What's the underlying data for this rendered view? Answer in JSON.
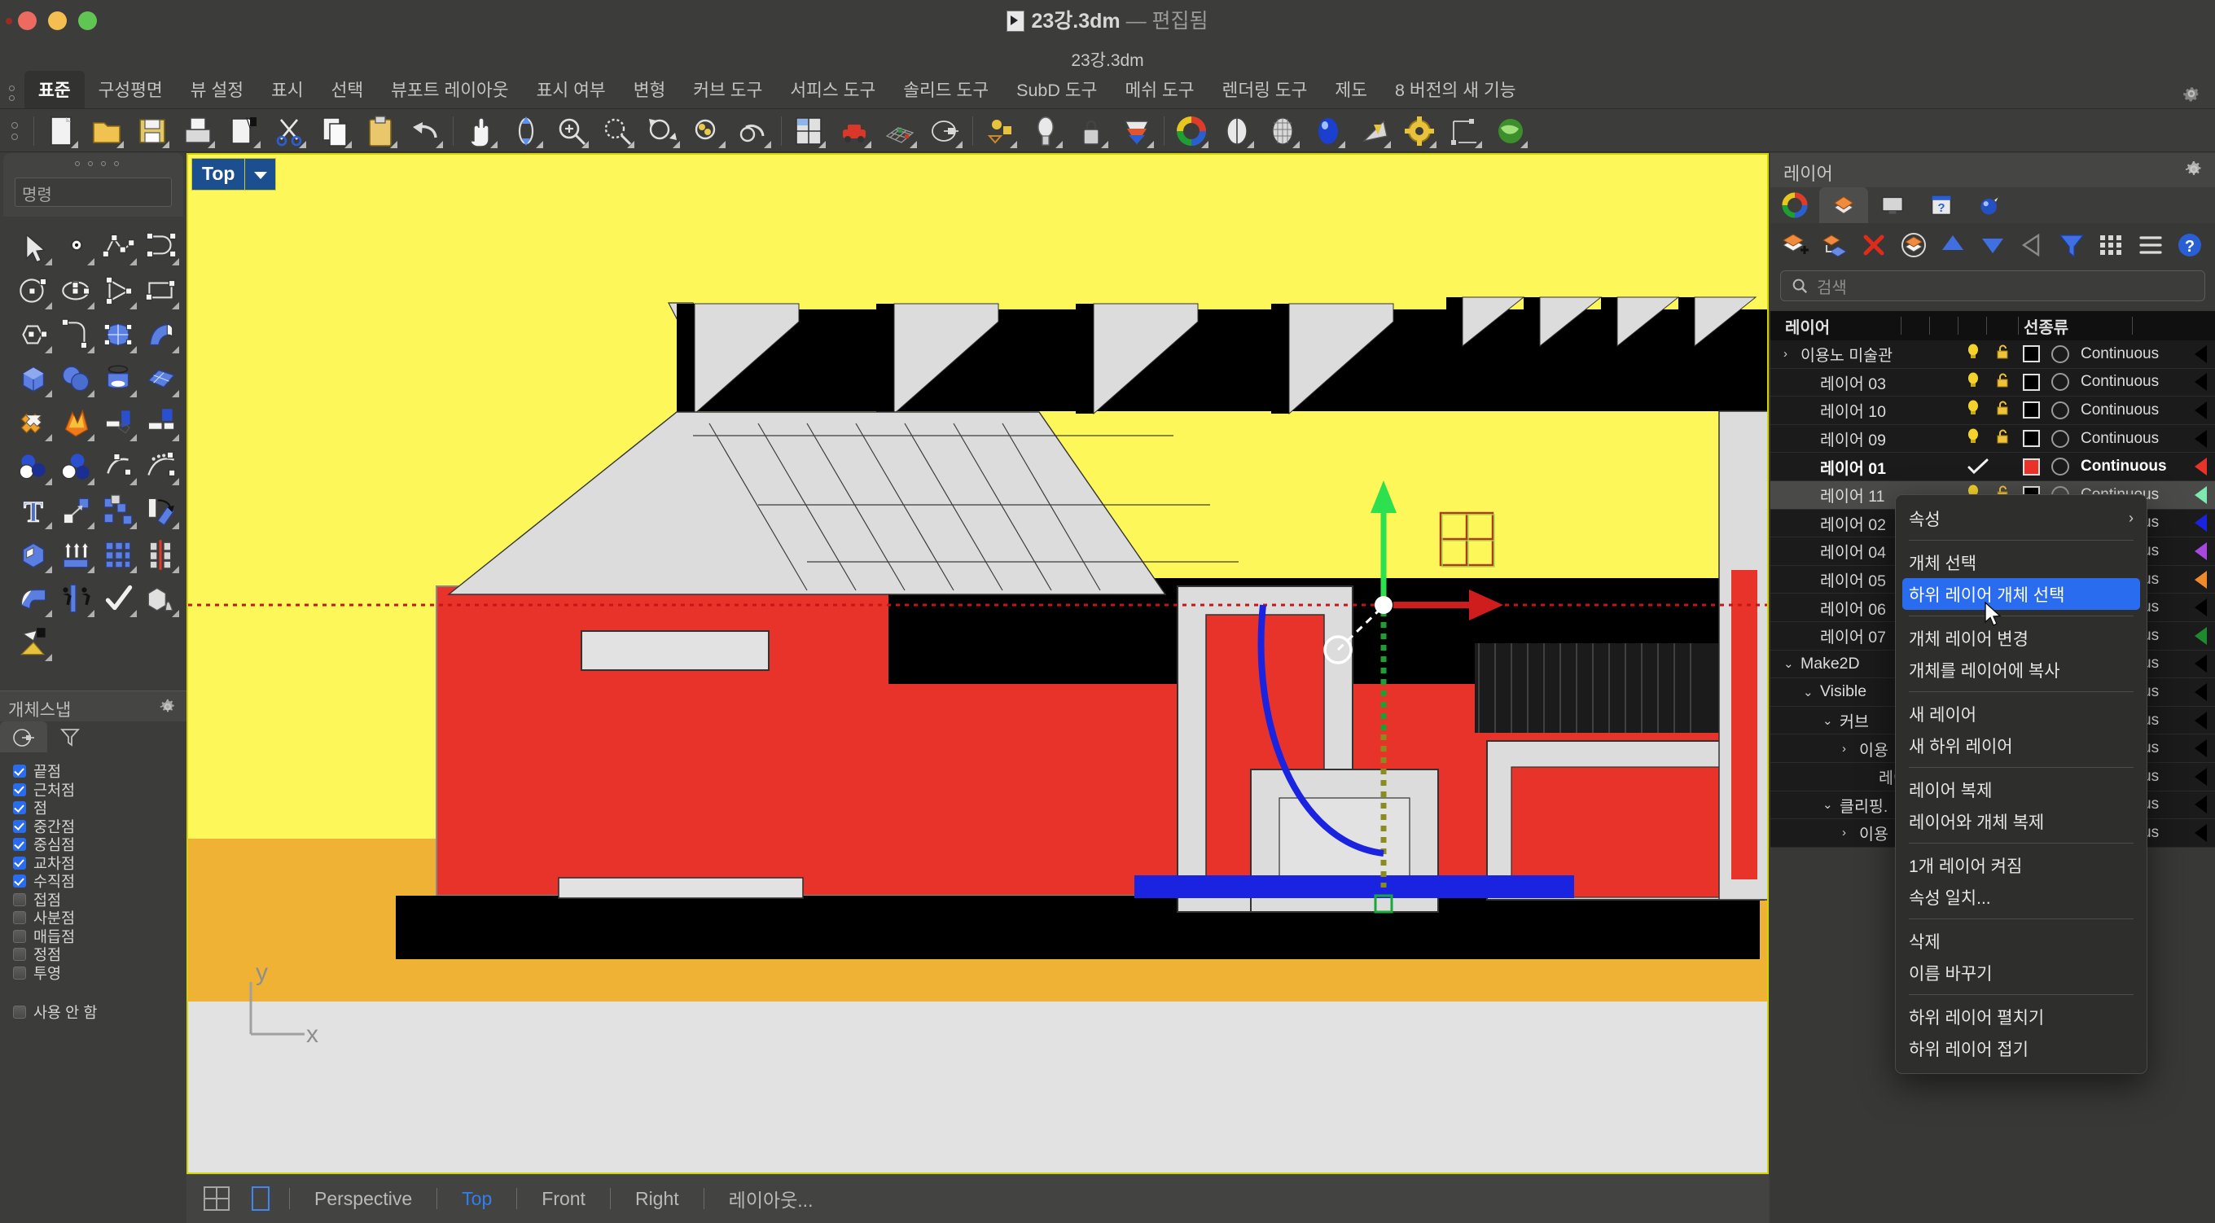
{
  "window": {
    "title": "23강.3dm",
    "title_dash": "—",
    "title_state": "편집됨",
    "subtitle": "23강.3dm"
  },
  "menubar": {
    "tabs": [
      {
        "label": "표준",
        "active": true
      },
      {
        "label": "구성평면",
        "active": false
      },
      {
        "label": "뷰 설정",
        "active": false
      },
      {
        "label": "표시",
        "active": false
      },
      {
        "label": "선택",
        "active": false
      },
      {
        "label": "뷰포트 레이아웃",
        "active": false
      },
      {
        "label": "표시 여부",
        "active": false
      },
      {
        "label": "변형",
        "active": false
      },
      {
        "label": "커브 도구",
        "active": false
      },
      {
        "label": "서피스 도구",
        "active": false
      },
      {
        "label": "솔리드 도구",
        "active": false
      },
      {
        "label": "SubD 도구",
        "active": false
      },
      {
        "label": "메쉬 도구",
        "active": false
      },
      {
        "label": "렌더링 도구",
        "active": false
      },
      {
        "label": "제도",
        "active": false
      },
      {
        "label": "8 버전의 새 기능",
        "active": false
      }
    ]
  },
  "toolbar": {
    "icons": [
      "new-file-icon",
      "open-folder-icon",
      "save-icon",
      "print-icon",
      "import-icon",
      "cut-scissors-icon",
      "copy-icon",
      "paste-icon",
      "undo-icon",
      "pan-hand-icon",
      "rotate-view-icon",
      "zoom-in-icon",
      "zoom-window-icon",
      "zoom-extents-icon",
      "zoom-selected-icon",
      "undo-view-icon",
      "viewport-layout-icon",
      "named-view-icon",
      "grid-snap-icon",
      "planar-icon",
      "gumball-icon",
      "light-icon",
      "lock-icon",
      "shaded-display-icon",
      "color-wheel-icon",
      "render-preview-icon",
      "render-mesh-icon",
      "render-icon",
      "spotlight-icon",
      "gear-options-icon",
      "dimension-icon",
      "environment-icon"
    ]
  },
  "command": {
    "placeholder": "명령"
  },
  "osnap": {
    "title": "개체스냅",
    "tabs": [
      "osnap-tab-icon",
      "filter-tab-icon"
    ],
    "items": [
      {
        "label": "끝점",
        "checked": true
      },
      {
        "label": "근처점",
        "checked": true
      },
      {
        "label": "점",
        "checked": true
      },
      {
        "label": "중간점",
        "checked": true
      },
      {
        "label": "중심점",
        "checked": true
      },
      {
        "label": "교차점",
        "checked": true
      },
      {
        "label": "수직점",
        "checked": true
      },
      {
        "label": "접점",
        "checked": false
      },
      {
        "label": "사분점",
        "checked": false
      },
      {
        "label": "매듭점",
        "checked": false
      },
      {
        "label": "정점",
        "checked": false
      },
      {
        "label": "투영",
        "checked": false
      }
    ],
    "disable": {
      "label": "사용 안 함",
      "checked": false
    }
  },
  "viewport": {
    "label": "Top",
    "axis_y": "y",
    "axis_x": "x",
    "bg_color": "#e2e2e2",
    "yellow": "#fdf75a",
    "orange": "#f0b235",
    "red": "#e8332a",
    "blue": "#1a23e0",
    "black": "#000000",
    "gray": "#dcdcdc"
  },
  "viewport_bar": {
    "icons": [
      "four-view-icon",
      "single-view-icon"
    ],
    "tabs": [
      {
        "label": "Perspective",
        "selected": false
      },
      {
        "label": "Top",
        "selected": true
      },
      {
        "label": "Front",
        "selected": false
      },
      {
        "label": "Right",
        "selected": false
      },
      {
        "label": "레이아웃...",
        "selected": false
      }
    ]
  },
  "layers_panel": {
    "title": "레이어",
    "tabs": [
      "color-wheel-tab-icon",
      "layers-tab-icon",
      "display-tab-icon",
      "help-tab-icon",
      "render-tab-icon"
    ],
    "tools": [
      "new-layer-icon",
      "new-sublayer-icon",
      "delete-layer-icon",
      "current-layer-icon",
      "move-up-icon",
      "move-down-icon",
      "filter-left-icon",
      "filter-funnel-icon",
      "grid-view-icon",
      "list-view-icon",
      "help-icon"
    ],
    "search_placeholder": "검색",
    "columns": {
      "name": "레이어",
      "linetype": "선종류"
    },
    "rows": [
      {
        "name": "이용노 미술관",
        "indent": 0,
        "chevron": "right",
        "bulb": true,
        "lock": true,
        "color": "#000000",
        "linetype": "Continuous",
        "print": "#000000",
        "current": false,
        "selected": false,
        "bold": false
      },
      {
        "name": "레이어 03",
        "indent": 1,
        "chevron": "",
        "bulb": true,
        "lock": true,
        "color": "#000000",
        "linetype": "Continuous",
        "print": "#000000",
        "current": false,
        "selected": false,
        "bold": false
      },
      {
        "name": "레이어 10",
        "indent": 1,
        "chevron": "",
        "bulb": true,
        "lock": true,
        "color": "#000000",
        "linetype": "Continuous",
        "print": "#000000",
        "current": false,
        "selected": false,
        "bold": false
      },
      {
        "name": "레이어 09",
        "indent": 1,
        "chevron": "",
        "bulb": true,
        "lock": true,
        "color": "#000000",
        "linetype": "Continuous",
        "print": "#000000",
        "current": false,
        "selected": false,
        "bold": false
      },
      {
        "name": "레이어 01",
        "indent": 1,
        "chevron": "",
        "bulb": false,
        "lock": false,
        "color": "#e8332a",
        "linetype": "Continuous",
        "print": "#e8332a",
        "current": true,
        "selected": false,
        "bold": true
      },
      {
        "name": "레이어 11",
        "indent": 1,
        "chevron": "",
        "bulb": true,
        "lock": true,
        "color": "#000000",
        "linetype": "Continuous",
        "print": "#7fe8b0",
        "current": false,
        "selected": true,
        "bold": false
      },
      {
        "name": "레이어 02",
        "indent": 1,
        "chevron": "",
        "bulb": true,
        "lock": true,
        "color": "#000000",
        "linetype": "Continuous",
        "print": "#1a23e0",
        "current": false,
        "selected": false,
        "bold": false
      },
      {
        "name": "레이어 04",
        "indent": 1,
        "chevron": "",
        "bulb": true,
        "lock": true,
        "color": "#000000",
        "linetype": "Continuous",
        "print": "#a648e0",
        "current": false,
        "selected": false,
        "bold": false
      },
      {
        "name": "레이어 05",
        "indent": 1,
        "chevron": "",
        "bulb": true,
        "lock": true,
        "color": "#000000",
        "linetype": "Continuous",
        "print": "#ef8a2b",
        "current": false,
        "selected": false,
        "bold": false
      },
      {
        "name": "레이어 06",
        "indent": 1,
        "chevron": "",
        "bulb": true,
        "lock": true,
        "color": "#000000",
        "linetype": "Continuous",
        "print": "#000000",
        "current": false,
        "selected": false,
        "bold": false
      },
      {
        "name": "레이어 07",
        "indent": 1,
        "chevron": "",
        "bulb": true,
        "lock": true,
        "color": "#000000",
        "linetype": "Continuous",
        "print": "#1e8a2e",
        "current": false,
        "selected": false,
        "bold": false
      },
      {
        "name": "Make2D",
        "indent": 0,
        "chevron": "down",
        "bulb": true,
        "lock": true,
        "color": "#000000",
        "linetype": "Continuous",
        "print": "#000000",
        "current": false,
        "selected": false,
        "bold": false
      },
      {
        "name": "Visible",
        "indent": 1,
        "chevron": "down",
        "bulb": true,
        "lock": true,
        "color": "#000000",
        "linetype": "Continuous",
        "print": "#000000",
        "current": false,
        "selected": false,
        "bold": false
      },
      {
        "name": "커브",
        "indent": 2,
        "chevron": "down",
        "bulb": true,
        "lock": true,
        "color": "#000000",
        "linetype": "Continuous",
        "print": "#000000",
        "current": false,
        "selected": false,
        "bold": false
      },
      {
        "name": "이용",
        "indent": 3,
        "chevron": "right",
        "bulb": true,
        "lock": true,
        "color": "#000000",
        "linetype": "Continuous",
        "print": "#000000",
        "current": false,
        "selected": false,
        "bold": false
      },
      {
        "name": "레이",
        "indent": 4,
        "chevron": "",
        "bulb": true,
        "lock": true,
        "color": "#000000",
        "linetype": "Continuous",
        "print": "#000000",
        "current": false,
        "selected": false,
        "bold": false
      },
      {
        "name": "클리핑.",
        "indent": 2,
        "chevron": "down",
        "bulb": true,
        "lock": true,
        "color": "#000000",
        "linetype": "Continuous",
        "print": "#000000",
        "current": false,
        "selected": false,
        "bold": false
      },
      {
        "name": "이용",
        "indent": 3,
        "chevron": "right",
        "bulb": true,
        "lock": true,
        "color": "#000000",
        "linetype": "Continuous",
        "print": "#000000",
        "current": false,
        "selected": false,
        "bold": false
      }
    ]
  },
  "context_menu": {
    "items": [
      {
        "label": "속성",
        "submenu": "›",
        "highlighted": false,
        "divider_after": true
      },
      {
        "label": "개체 선택",
        "submenu": "",
        "highlighted": false,
        "divider_after": false
      },
      {
        "label": "하위 레이어 개체 선택",
        "submenu": "",
        "highlighted": true,
        "divider_after": true
      },
      {
        "label": "개체 레이어 변경",
        "submenu": "",
        "highlighted": false,
        "divider_after": false
      },
      {
        "label": "개체를 레이어에 복사",
        "submenu": "",
        "highlighted": false,
        "divider_after": true
      },
      {
        "label": "새 레이어",
        "submenu": "",
        "highlighted": false,
        "divider_after": false
      },
      {
        "label": "새 하위 레이어",
        "submenu": "",
        "highlighted": false,
        "divider_after": true
      },
      {
        "label": "레이어 복제",
        "submenu": "",
        "highlighted": false,
        "divider_after": false
      },
      {
        "label": "레이어와 개체 복제",
        "submenu": "",
        "highlighted": false,
        "divider_after": true
      },
      {
        "label": "1개 레이어 켜짐",
        "submenu": "",
        "highlighted": false,
        "divider_after": false
      },
      {
        "label": "속성 일치...",
        "submenu": "",
        "highlighted": false,
        "divider_after": true
      },
      {
        "label": "삭제",
        "submenu": "",
        "highlighted": false,
        "divider_after": false
      },
      {
        "label": "이름 바꾸기",
        "submenu": "",
        "highlighted": false,
        "divider_after": true
      },
      {
        "label": "하위 레이어 펼치기",
        "submenu": "",
        "highlighted": false,
        "divider_after": false
      },
      {
        "label": "하위 레이어 접기",
        "submenu": "",
        "highlighted": false,
        "divider_after": false
      }
    ]
  }
}
